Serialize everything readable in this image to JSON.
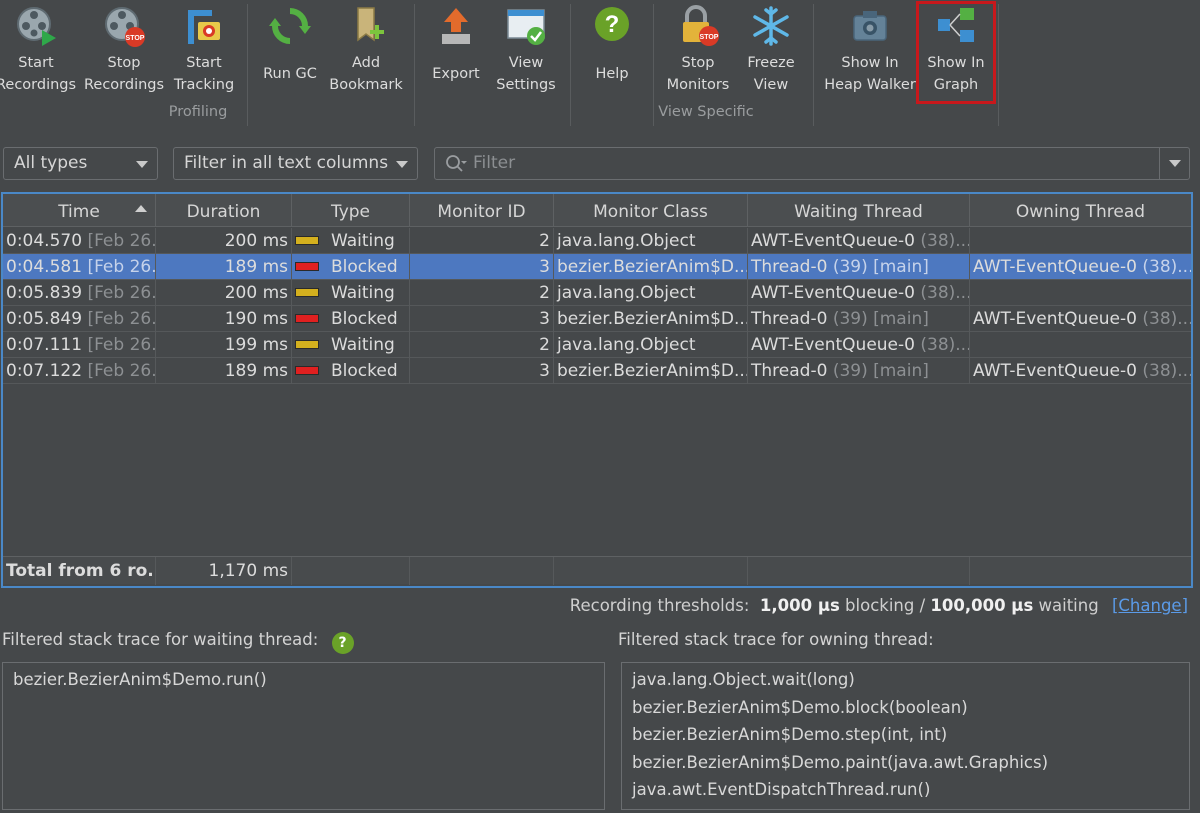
{
  "toolbar": {
    "buttons": [
      {
        "label": "Start\nRecordings",
        "icon": "start-recordings-icon"
      },
      {
        "label": "Stop\nRecordings",
        "icon": "stop-recordings-icon"
      },
      {
        "label": "Start\nTracking",
        "icon": "start-tracking-icon"
      },
      {
        "label": "Run GC",
        "icon": "run-gc-icon"
      },
      {
        "label": "Add\nBookmark",
        "icon": "add-bookmark-icon"
      },
      {
        "label": "Export",
        "icon": "export-icon"
      },
      {
        "label": "View\nSettings",
        "icon": "view-settings-icon"
      },
      {
        "label": "Help",
        "icon": "help-icon"
      },
      {
        "label": "Stop\nMonitors",
        "icon": "stop-monitors-icon"
      },
      {
        "label": "Freeze\nView",
        "icon": "freeze-view-icon"
      },
      {
        "label": "Show In\nHeap Walker",
        "icon": "show-in-heap-walker-icon"
      },
      {
        "label": "Show In\nGraph",
        "icon": "show-in-graph-icon"
      }
    ],
    "groups": {
      "profiling": "Profiling",
      "view_specific": "View Specific"
    }
  },
  "filters": {
    "type_select": "All types",
    "column_select": "Filter in all text columns",
    "search_placeholder": "Filter"
  },
  "table": {
    "columns": [
      "Time",
      "Duration",
      "Type",
      "Monitor ID",
      "Monitor Class",
      "Waiting Thread",
      "Owning Thread"
    ],
    "sorted_column": "Time",
    "sort_direction": "ascending",
    "rows": [
      {
        "time": "0:04.570",
        "date": "[Feb 26...",
        "duration": "200 ms",
        "type": "Waiting",
        "type_color": "#d4b01e",
        "monitor_id": "2",
        "monitor_class": "java.lang.Object",
        "waiting_thread": "AWT-EventQueue-0",
        "waiting_thread_detail": "(38)...",
        "owning_thread": "",
        "owning_thread_detail": "",
        "selected": false
      },
      {
        "time": "0:04.581",
        "date": "[Feb 26...",
        "duration": "189 ms",
        "type": "Blocked",
        "type_color": "#e02020",
        "monitor_id": "3",
        "monitor_class": "bezier.BezierAnim$D...",
        "waiting_thread": "Thread-0",
        "waiting_thread_detail": "(39) [main]",
        "owning_thread": "AWT-EventQueue-0",
        "owning_thread_detail": "(38)...",
        "selected": true
      },
      {
        "time": "0:05.839",
        "date": "[Feb 26...",
        "duration": "200 ms",
        "type": "Waiting",
        "type_color": "#d4b01e",
        "monitor_id": "2",
        "monitor_class": "java.lang.Object",
        "waiting_thread": "AWT-EventQueue-0",
        "waiting_thread_detail": "(38)...",
        "owning_thread": "",
        "owning_thread_detail": "",
        "selected": false
      },
      {
        "time": "0:05.849",
        "date": "[Feb 26...",
        "duration": "190 ms",
        "type": "Blocked",
        "type_color": "#e02020",
        "monitor_id": "3",
        "monitor_class": "bezier.BezierAnim$D...",
        "waiting_thread": "Thread-0",
        "waiting_thread_detail": "(39) [main]",
        "owning_thread": "AWT-EventQueue-0",
        "owning_thread_detail": "(38)...",
        "selected": false
      },
      {
        "time": "0:07.111",
        "date": "[Feb 26...",
        "duration": "199 ms",
        "type": "Waiting",
        "type_color": "#d4b01e",
        "monitor_id": "2",
        "monitor_class": "java.lang.Object",
        "waiting_thread": "AWT-EventQueue-0",
        "waiting_thread_detail": "(38)...",
        "owning_thread": "",
        "owning_thread_detail": "",
        "selected": false
      },
      {
        "time": "0:07.122",
        "date": "[Feb 26...",
        "duration": "189 ms",
        "type": "Blocked",
        "type_color": "#e02020",
        "monitor_id": "3",
        "monitor_class": "bezier.BezierAnim$D...",
        "waiting_thread": "Thread-0",
        "waiting_thread_detail": "(39) [main]",
        "owning_thread": "AWT-EventQueue-0",
        "owning_thread_detail": "(38)...",
        "selected": false
      }
    ],
    "total": {
      "label": "Total from 6 ro...",
      "duration": "1,170 ms"
    }
  },
  "thresholds": {
    "prefix": "Recording thresholds:",
    "blocking_value": "1,000 µs",
    "blocking_label": "blocking /",
    "waiting_value": "100,000 µs",
    "waiting_label": "waiting",
    "change_link": "[Change]"
  },
  "stack_traces": {
    "waiting_title": "Filtered stack trace for waiting thread:",
    "waiting_frames": [
      "bezier.BezierAnim$Demo.run()"
    ],
    "owning_title": "Filtered stack trace for owning thread:",
    "owning_frames": [
      "java.lang.Object.wait(long)",
      "bezier.BezierAnim$Demo.block(boolean)",
      "bezier.BezierAnim$Demo.step(int, int)",
      "bezier.BezierAnim$Demo.paint(java.awt.Graphics)",
      "java.awt.EventDispatchThread.run()"
    ]
  }
}
